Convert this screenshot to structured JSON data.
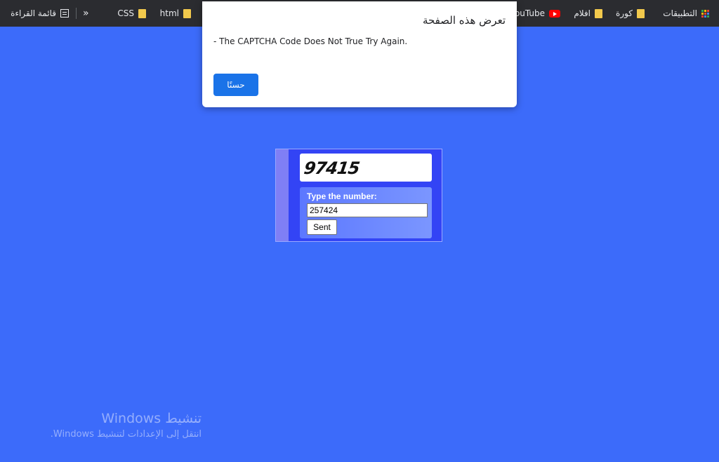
{
  "bookmarks": {
    "apps_label": "التطبيقات",
    "items": [
      {
        "label": "كورة",
        "icon": "folder-icon"
      },
      {
        "label": "افلام",
        "icon": "folder-icon"
      },
      {
        "label": "YouTube",
        "icon": "youtube-icon"
      },
      {
        "label": "html",
        "icon": "folder-icon"
      },
      {
        "label": "CSS",
        "icon": "folder-icon"
      }
    ],
    "overflow_icon": "»",
    "reading_list_label": "قائمة القراءة"
  },
  "dialog": {
    "title": "تعرض هذه الصفحة",
    "message": "- The CAPTCHA Code Does Not True Try Again.",
    "ok_label": "حسنًا",
    "button_color": "#1a73e8"
  },
  "captcha": {
    "code": "97415",
    "label": "Type the number:",
    "input_value": "257424",
    "submit_label": "Sent"
  },
  "watermark": {
    "line1": "تنشيط Windows",
    "line2": "انتقل إلى الإعدادات لتنشيط Windows."
  },
  "colors": {
    "page_background": "#3c6bfa",
    "bookmarks_bar": "#2b2c30"
  }
}
